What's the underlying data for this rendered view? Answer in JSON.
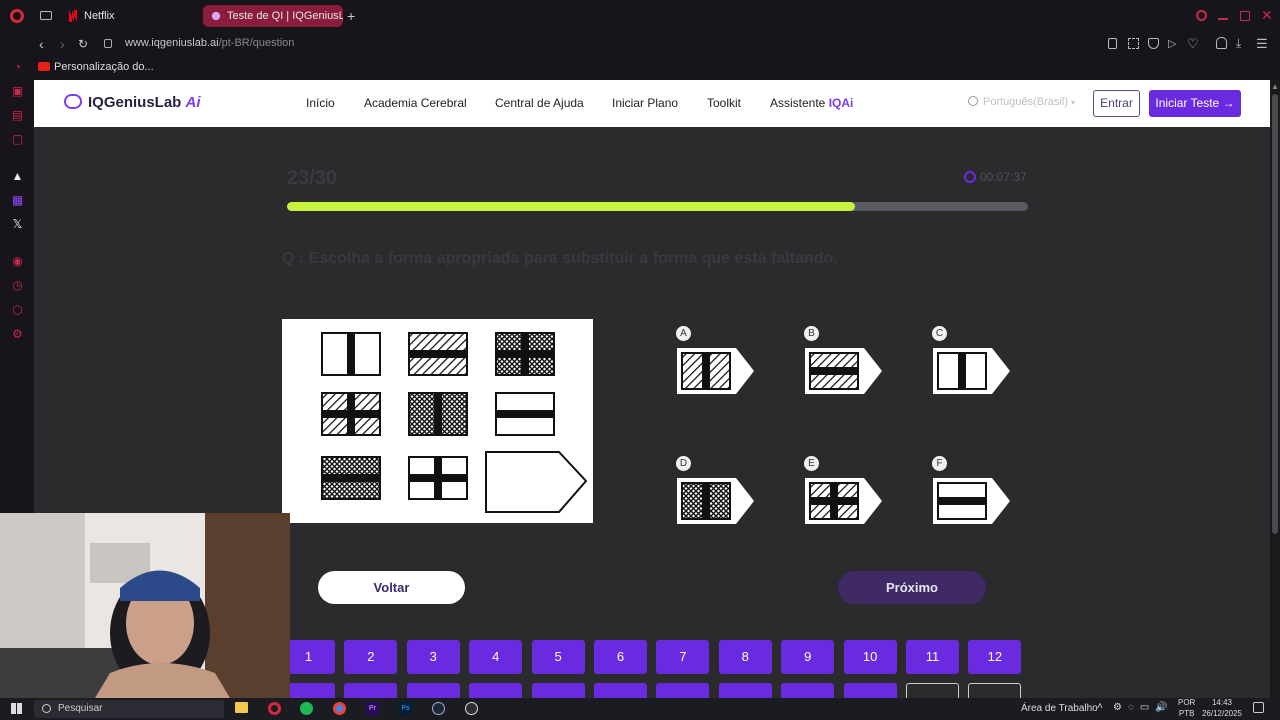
{
  "browser": {
    "tabs": [
      {
        "label": "Netflix"
      },
      {
        "label": "Teste de QI | IQGeniusLab"
      }
    ],
    "url_domain": "www.iqgeniuslab.ai",
    "url_path": "/pt-BR/question",
    "bookmark": "Personalização do..."
  },
  "nav": {
    "logo_main": "IQGeniusLab",
    "logo_ai": "Ai",
    "links": [
      "Início",
      "Academia Cerebral",
      "Central de Ajuda",
      "Iniciar Plano",
      "Toolkit"
    ],
    "assistant_label": "Assistente",
    "assistant_badge": "IQAi",
    "language": "Português(Brasil)",
    "login_label": "Entrar",
    "start_label": "Iniciar Teste"
  },
  "quiz": {
    "counter": "23/30",
    "timer": "00:07:37",
    "progress": 0.766,
    "question": "Q :  Escolha a forma apropriada para substituir a forma que está faltando.",
    "options": [
      "A",
      "B",
      "C",
      "D",
      "E",
      "F"
    ],
    "back_label": "Voltar",
    "next_label": "Próximo",
    "numbers": [
      "1",
      "2",
      "3",
      "4",
      "5",
      "6",
      "7",
      "8",
      "9",
      "10",
      "11",
      "12"
    ]
  },
  "taskbar": {
    "search": "Pesquisar",
    "desktop": "Área de Trabalho",
    "lang1": "POR",
    "lang2": "PTB",
    "time": "14:43",
    "date": "26/12/2025"
  },
  "colors": {
    "accent": "#6a2be0",
    "progress": "#c6f33c",
    "brand_red": "#c6284a"
  }
}
